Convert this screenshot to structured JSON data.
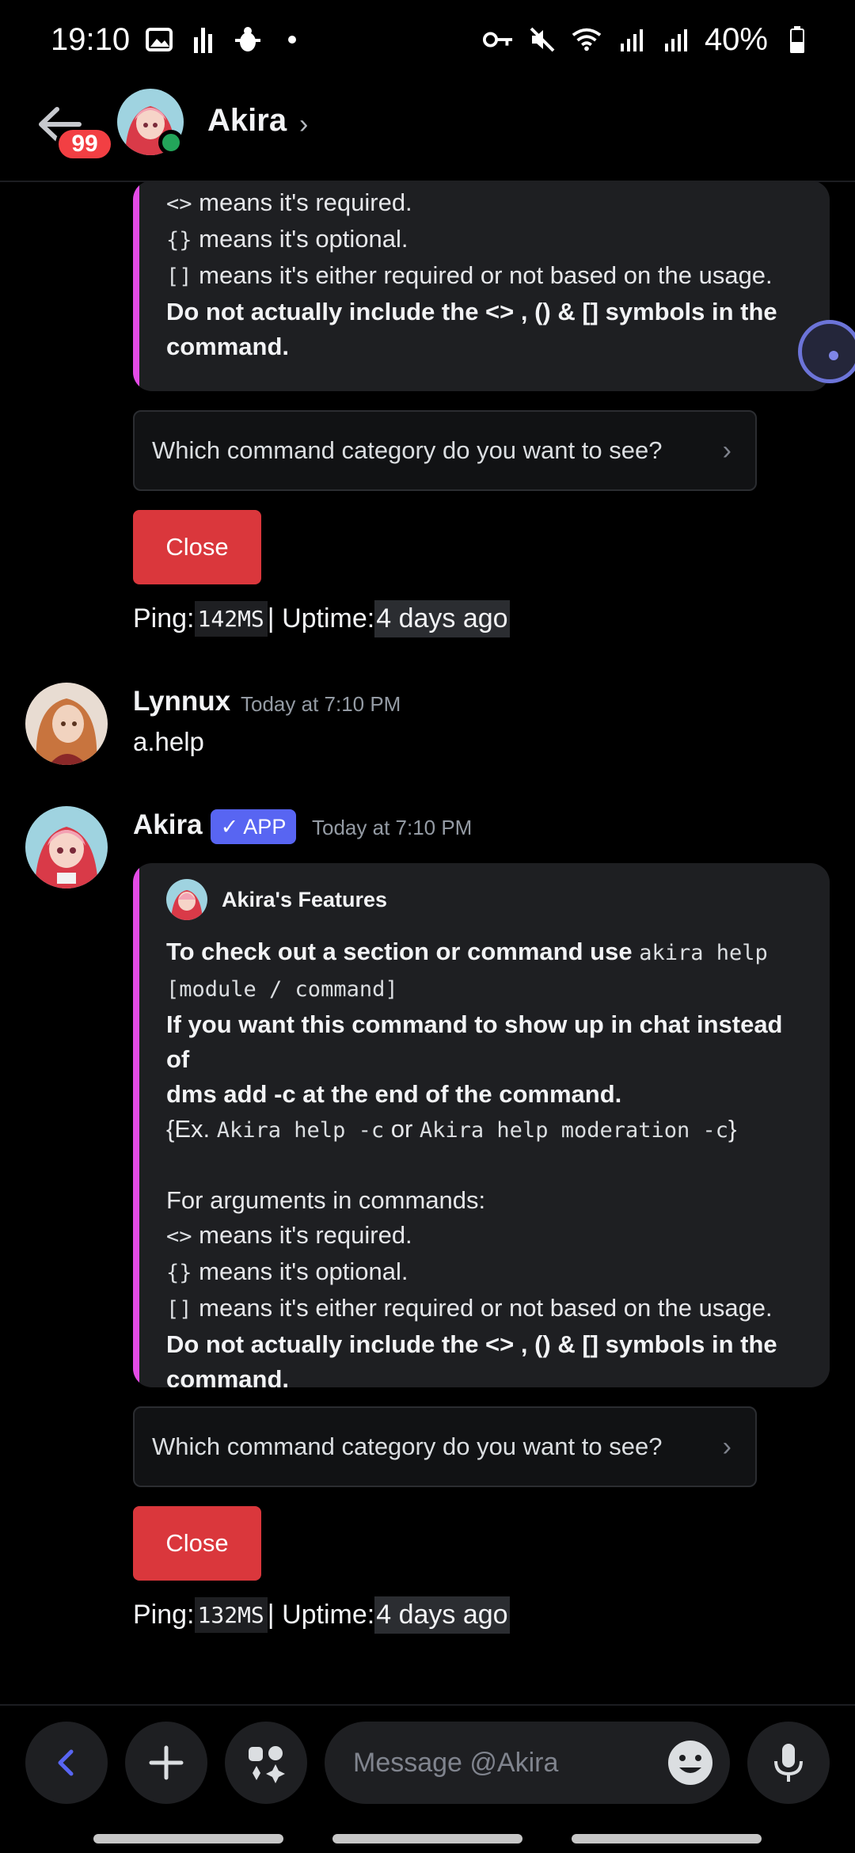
{
  "status_bar": {
    "time": "19:10",
    "battery": "40%",
    "icons_left": [
      "gallery-icon",
      "stats-icon",
      "bug-icon",
      "dot-icon"
    ],
    "icons_right": [
      "key-icon",
      "mute-icon",
      "wifi-icon",
      "signal-icon",
      "signal-icon",
      "battery-icon"
    ]
  },
  "header": {
    "name": "Akira",
    "unread_badge": "99"
  },
  "embed_top": {
    "lines": [
      {
        "code": "<>",
        "text": " means it's required."
      },
      {
        "code": "{}",
        "text": " means it's optional."
      },
      {
        "code": "[]",
        "text": " means it's either required or not based on the usage."
      }
    ],
    "bold_line_1": "Do not actually include the <> , () & [] symbols in the",
    "bold_line_2": "command."
  },
  "select_top": {
    "label": "Which command category do you want to see?"
  },
  "close_top": {
    "label": "Close"
  },
  "ping_top": {
    "prefix": "Ping: ",
    "ping": "142MS",
    "mid": " | Uptime: ",
    "uptime": "4 days ago"
  },
  "message_user": {
    "author": "Lynnux",
    "time": "Today at 7:10 PM",
    "text": "a.help"
  },
  "message_bot": {
    "author": "Akira",
    "tag": "APP",
    "time": "Today at 7:10 PM",
    "embed": {
      "author": "Akira's Features",
      "line1_bold": "To check out a section or command use ",
      "line1_code": "akira help",
      "line2_code": "[module / command]",
      "line3_bold": "If you want this command to show up in chat instead of",
      "line4_bold": "dms add -c at the end of the command.",
      "line5_pre": "{Ex. ",
      "line5_code1": "Akira help -c",
      "line5_mid": " or ",
      "line5_code2": "Akira help moderation -c",
      "line5_post": "}",
      "args_title": "For arguments in commands:",
      "lines": [
        {
          "code": "<>",
          "text": " means it's required."
        },
        {
          "code": "{}",
          "text": " means it's optional."
        },
        {
          "code": "[]",
          "text": " means it's either required or not based on the usage."
        }
      ],
      "bold_line_1": "Do not actually include the <> , () & [] symbols in the",
      "bold_line_2": "command."
    },
    "select": {
      "label": "Which command category do you want to see?"
    },
    "close": {
      "label": "Close"
    },
    "ping": {
      "prefix": "Ping: ",
      "ping": "132MS",
      "mid": " | Uptime: ",
      "uptime": "4 days ago"
    }
  },
  "input": {
    "placeholder": "Message @Akira"
  },
  "colors": {
    "accent": "#5865f2",
    "embed_bar": "#e44be6",
    "danger": "#da373c",
    "online": "#23a55a"
  }
}
